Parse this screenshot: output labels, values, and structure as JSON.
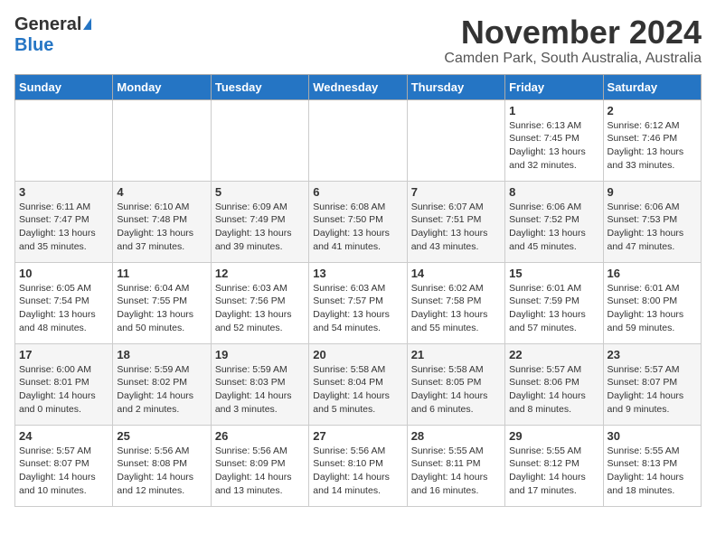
{
  "logo": {
    "general": "General",
    "blue": "Blue"
  },
  "title": {
    "month": "November 2024",
    "location": "Camden Park, South Australia, Australia"
  },
  "weekdays": [
    "Sunday",
    "Monday",
    "Tuesday",
    "Wednesday",
    "Thursday",
    "Friday",
    "Saturday"
  ],
  "weeks": [
    [
      {
        "day": "",
        "info": ""
      },
      {
        "day": "",
        "info": ""
      },
      {
        "day": "",
        "info": ""
      },
      {
        "day": "",
        "info": ""
      },
      {
        "day": "",
        "info": ""
      },
      {
        "day": "1",
        "info": "Sunrise: 6:13 AM\nSunset: 7:45 PM\nDaylight: 13 hours\nand 32 minutes."
      },
      {
        "day": "2",
        "info": "Sunrise: 6:12 AM\nSunset: 7:46 PM\nDaylight: 13 hours\nand 33 minutes."
      }
    ],
    [
      {
        "day": "3",
        "info": "Sunrise: 6:11 AM\nSunset: 7:47 PM\nDaylight: 13 hours\nand 35 minutes."
      },
      {
        "day": "4",
        "info": "Sunrise: 6:10 AM\nSunset: 7:48 PM\nDaylight: 13 hours\nand 37 minutes."
      },
      {
        "day": "5",
        "info": "Sunrise: 6:09 AM\nSunset: 7:49 PM\nDaylight: 13 hours\nand 39 minutes."
      },
      {
        "day": "6",
        "info": "Sunrise: 6:08 AM\nSunset: 7:50 PM\nDaylight: 13 hours\nand 41 minutes."
      },
      {
        "day": "7",
        "info": "Sunrise: 6:07 AM\nSunset: 7:51 PM\nDaylight: 13 hours\nand 43 minutes."
      },
      {
        "day": "8",
        "info": "Sunrise: 6:06 AM\nSunset: 7:52 PM\nDaylight: 13 hours\nand 45 minutes."
      },
      {
        "day": "9",
        "info": "Sunrise: 6:06 AM\nSunset: 7:53 PM\nDaylight: 13 hours\nand 47 minutes."
      }
    ],
    [
      {
        "day": "10",
        "info": "Sunrise: 6:05 AM\nSunset: 7:54 PM\nDaylight: 13 hours\nand 48 minutes."
      },
      {
        "day": "11",
        "info": "Sunrise: 6:04 AM\nSunset: 7:55 PM\nDaylight: 13 hours\nand 50 minutes."
      },
      {
        "day": "12",
        "info": "Sunrise: 6:03 AM\nSunset: 7:56 PM\nDaylight: 13 hours\nand 52 minutes."
      },
      {
        "day": "13",
        "info": "Sunrise: 6:03 AM\nSunset: 7:57 PM\nDaylight: 13 hours\nand 54 minutes."
      },
      {
        "day": "14",
        "info": "Sunrise: 6:02 AM\nSunset: 7:58 PM\nDaylight: 13 hours\nand 55 minutes."
      },
      {
        "day": "15",
        "info": "Sunrise: 6:01 AM\nSunset: 7:59 PM\nDaylight: 13 hours\nand 57 minutes."
      },
      {
        "day": "16",
        "info": "Sunrise: 6:01 AM\nSunset: 8:00 PM\nDaylight: 13 hours\nand 59 minutes."
      }
    ],
    [
      {
        "day": "17",
        "info": "Sunrise: 6:00 AM\nSunset: 8:01 PM\nDaylight: 14 hours\nand 0 minutes."
      },
      {
        "day": "18",
        "info": "Sunrise: 5:59 AM\nSunset: 8:02 PM\nDaylight: 14 hours\nand 2 minutes."
      },
      {
        "day": "19",
        "info": "Sunrise: 5:59 AM\nSunset: 8:03 PM\nDaylight: 14 hours\nand 3 minutes."
      },
      {
        "day": "20",
        "info": "Sunrise: 5:58 AM\nSunset: 8:04 PM\nDaylight: 14 hours\nand 5 minutes."
      },
      {
        "day": "21",
        "info": "Sunrise: 5:58 AM\nSunset: 8:05 PM\nDaylight: 14 hours\nand 6 minutes."
      },
      {
        "day": "22",
        "info": "Sunrise: 5:57 AM\nSunset: 8:06 PM\nDaylight: 14 hours\nand 8 minutes."
      },
      {
        "day": "23",
        "info": "Sunrise: 5:57 AM\nSunset: 8:07 PM\nDaylight: 14 hours\nand 9 minutes."
      }
    ],
    [
      {
        "day": "24",
        "info": "Sunrise: 5:57 AM\nSunset: 8:07 PM\nDaylight: 14 hours\nand 10 minutes."
      },
      {
        "day": "25",
        "info": "Sunrise: 5:56 AM\nSunset: 8:08 PM\nDaylight: 14 hours\nand 12 minutes."
      },
      {
        "day": "26",
        "info": "Sunrise: 5:56 AM\nSunset: 8:09 PM\nDaylight: 14 hours\nand 13 minutes."
      },
      {
        "day": "27",
        "info": "Sunrise: 5:56 AM\nSunset: 8:10 PM\nDaylight: 14 hours\nand 14 minutes."
      },
      {
        "day": "28",
        "info": "Sunrise: 5:55 AM\nSunset: 8:11 PM\nDaylight: 14 hours\nand 16 minutes."
      },
      {
        "day": "29",
        "info": "Sunrise: 5:55 AM\nSunset: 8:12 PM\nDaylight: 14 hours\nand 17 minutes."
      },
      {
        "day": "30",
        "info": "Sunrise: 5:55 AM\nSunset: 8:13 PM\nDaylight: 14 hours\nand 18 minutes."
      }
    ]
  ]
}
